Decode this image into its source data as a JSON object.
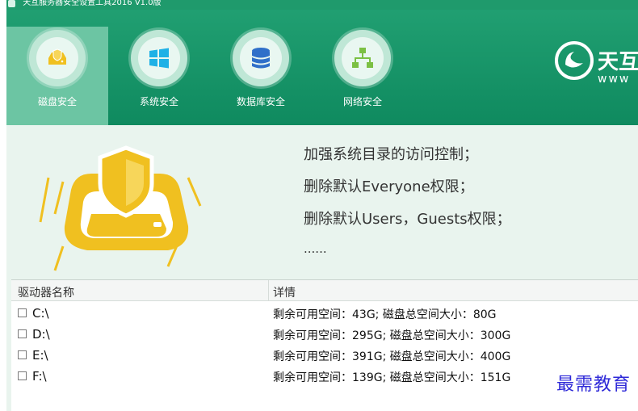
{
  "window": {
    "title": "天互服务器安全设置工具2016 V1.0版"
  },
  "tabs": [
    {
      "label": "磁盘安全",
      "icon": "disk-shield-icon"
    },
    {
      "label": "系统安全",
      "icon": "windows-icon"
    },
    {
      "label": "数据库安全",
      "icon": "database-icon"
    },
    {
      "label": "网络安全",
      "icon": "network-icon"
    }
  ],
  "logo": {
    "brand": "天互",
    "sub": "www"
  },
  "info": {
    "lines": [
      "加强系统目录的访问控制；",
      "删除默认Everyone权限；",
      "删除默认Users，Guests权限；",
      "......"
    ]
  },
  "table": {
    "headers": [
      "驱动器名称",
      "详情"
    ],
    "rows": [
      {
        "drive": "C:\\",
        "detail": "剩余可用空间：43G; 磁盘总空间大小：80G"
      },
      {
        "drive": "D:\\",
        "detail": "剩余可用空间：295G; 磁盘总空间大小：300G"
      },
      {
        "drive": "E:\\",
        "detail": "剩余可用空间：391G; 磁盘总空间大小：400G"
      },
      {
        "drive": "F:\\",
        "detail": "剩余可用空间：139G; 磁盘总空间大小：151G"
      }
    ]
  },
  "watermark": "最需教育",
  "colors": {
    "header": "#1a9a6b",
    "active_tab": "#6cc5a3",
    "accent_gold": "#f0c020"
  }
}
